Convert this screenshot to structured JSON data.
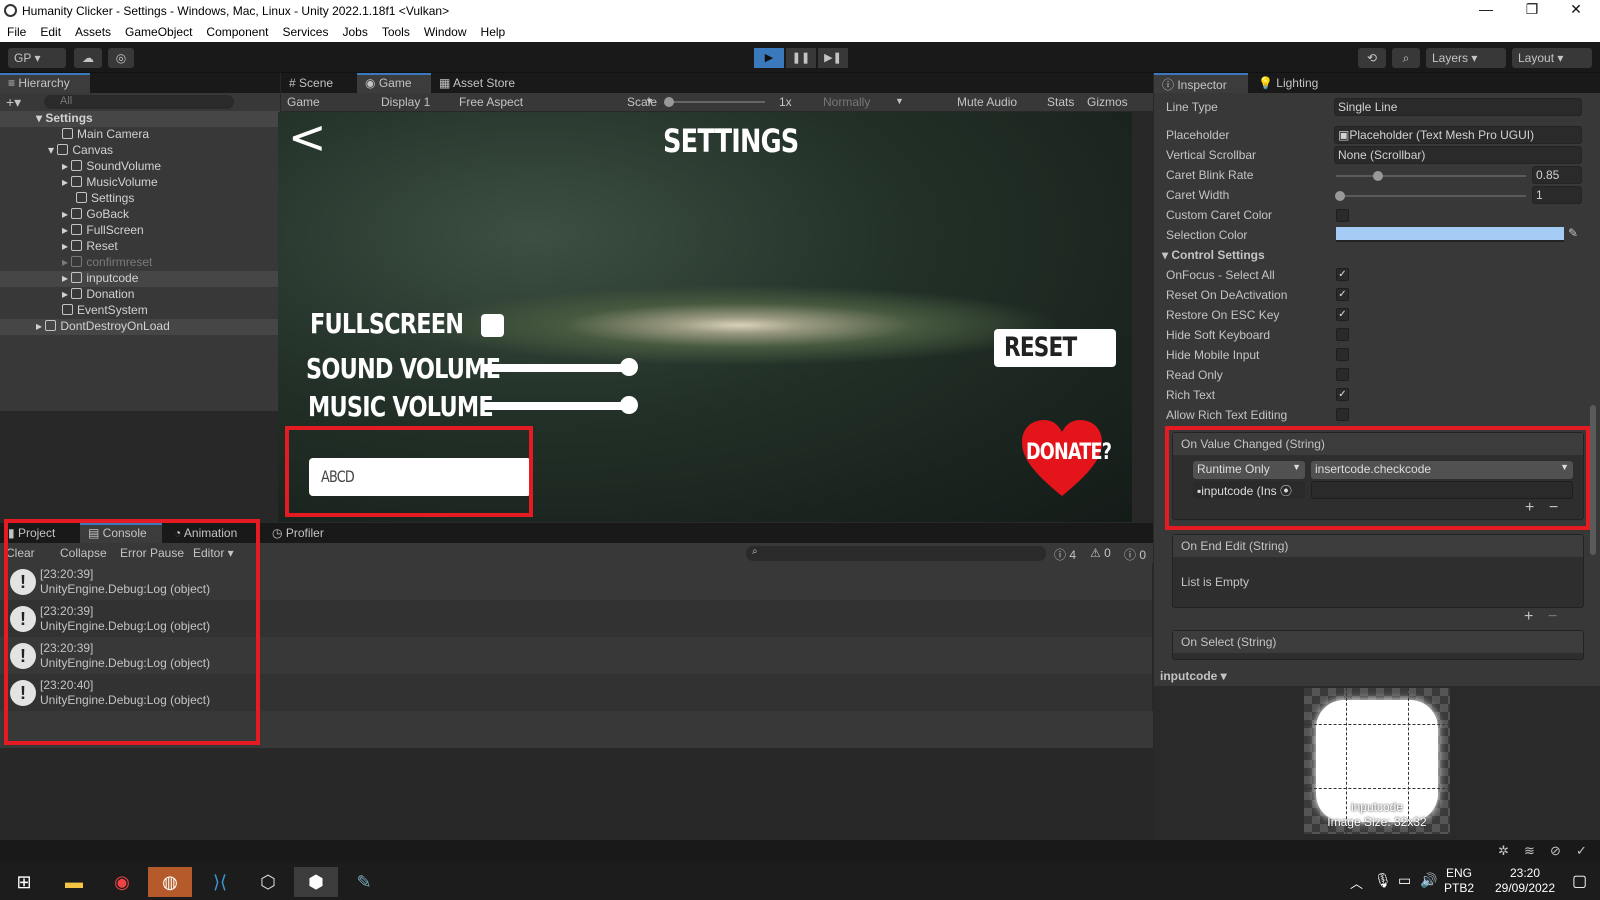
{
  "window": {
    "title": "Humanity Clicker - Settings - Windows, Mac, Linux - Unity 2022.1.18f1 <Vulkan>",
    "min": "—",
    "max": "❐",
    "close": "✕"
  },
  "menu": [
    "File",
    "Edit",
    "Assets",
    "GameObject",
    "Component",
    "Services",
    "Jobs",
    "Tools",
    "Window",
    "Help"
  ],
  "toolbar": {
    "account": "GP ▾",
    "layers": "Layers",
    "layout": "Layout",
    "play": "▶",
    "pause": "❚❚",
    "step": "▶❚"
  },
  "hierarchy": {
    "tab": "Hierarchy",
    "search_placeholder": "All",
    "items": [
      {
        "label": "Settings",
        "indent": 0
      },
      {
        "label": "Main Camera",
        "indent": 2
      },
      {
        "label": "Canvas",
        "indent": 1
      },
      {
        "label": "SoundVolume",
        "indent": 3
      },
      {
        "label": "MusicVolume",
        "indent": 3
      },
      {
        "label": "Settings",
        "indent": 3
      },
      {
        "label": "GoBack",
        "indent": 3
      },
      {
        "label": "FullScreen",
        "indent": 3
      },
      {
        "label": "Reset",
        "indent": 3
      },
      {
        "label": "confirmreset",
        "indent": 3
      },
      {
        "label": "inputcode",
        "indent": 3
      },
      {
        "label": "Donation",
        "indent": 3
      },
      {
        "label": "EventSystem",
        "indent": 2
      },
      {
        "label": "DontDestroyOnLoad",
        "indent": 0
      }
    ]
  },
  "view_tabs": {
    "scene": "Scene",
    "game": "Game",
    "asset_store": "Asset Store"
  },
  "game_bar": {
    "mode": "Game",
    "display": "Display 1",
    "aspect": "Free Aspect",
    "scale_label": "Scale",
    "scale_value": "1x",
    "normally": "Normally",
    "mute": "Mute Audio",
    "stats": "Stats",
    "gizmos": "Gizmos"
  },
  "game": {
    "title": "SETTINGS",
    "back": "<",
    "fullscreen": "FULLSCREEN",
    "sound": "SOUND VOLUME",
    "music": "MUSIC VOLUME",
    "reset": "RESET SAVE",
    "donate": "DONATE?",
    "input_value": "ABCD",
    "sound_level": 1.0,
    "music_level": 1.0
  },
  "bottom_tabs": {
    "project": "Project",
    "console": "Console",
    "animation": "Animation",
    "profiler": "Profiler"
  },
  "console": {
    "clear": "Clear",
    "collapse": "Collapse",
    "error_pause": "Error Pause",
    "editor": "Editor ▾",
    "count_info": "4",
    "count_warn": "0",
    "count_err": "0",
    "logs": [
      {
        "time": "[23:20:39]",
        "msg": "UnityEngine.Debug:Log (object)"
      },
      {
        "time": "[23:20:39]",
        "msg": "UnityEngine.Debug:Log (object)"
      },
      {
        "time": "[23:20:39]",
        "msg": "UnityEngine.Debug:Log (object)"
      },
      {
        "time": "[23:20:40]",
        "msg": "UnityEngine.Debug:Log (object)"
      }
    ]
  },
  "inspector": {
    "tab": "Inspector",
    "lighting": "Lighting",
    "line_type": {
      "label": "Line Type",
      "value": "Single Line"
    },
    "placeholder": {
      "label": "Placeholder",
      "value": "Placeholder (Text Mesh Pro UGUI)"
    },
    "scrollbar": {
      "label": "Vertical Scrollbar",
      "value": "None (Scrollbar)"
    },
    "caret_blink": {
      "label": "Caret Blink Rate",
      "value": "0.85"
    },
    "caret_width": {
      "label": "Caret Width",
      "value": "1"
    },
    "custom_caret": "Custom Caret Color",
    "selection_color": "Selection Color",
    "control_settings": "Control Settings",
    "checks": [
      {
        "label": "OnFocus - Select All",
        "on": true
      },
      {
        "label": "Reset On DeActivation",
        "on": true
      },
      {
        "label": "Restore On ESC Key",
        "on": true
      },
      {
        "label": "Hide Soft Keyboard",
        "on": false
      },
      {
        "label": "Hide Mobile Input",
        "on": false
      },
      {
        "label": "Read Only",
        "on": false
      },
      {
        "label": "Rich Text",
        "on": true
      },
      {
        "label": "Allow Rich Text Editing",
        "on": false
      }
    ],
    "on_value_changed": "On Value Changed (String)",
    "runtime": "Runtime Only",
    "function": "insertcode.checkcode",
    "target": "inputcode (Ins",
    "on_end_edit": "On End Edit (String)",
    "list_empty": "List is Empty",
    "on_select": "On Select (String)",
    "preview_name": "inputcode ▾",
    "preview_caption": "inputcode",
    "image_size": "Image Size: 32x32"
  },
  "taskbar": {
    "lang1": "ENG",
    "lang2": "PTB2",
    "time": "23:20",
    "date": "29/09/2022"
  },
  "colors": {
    "accent": "#3a79bb",
    "highlight": "#e41b23",
    "selection": "#a5ccf5"
  }
}
